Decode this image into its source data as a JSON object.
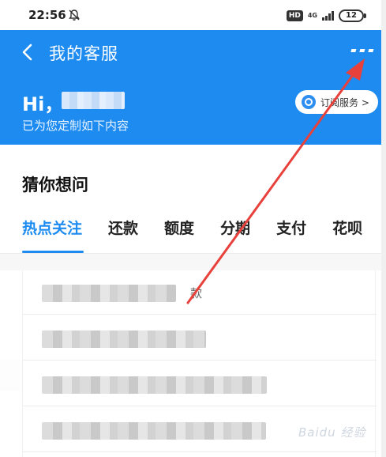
{
  "status_bar": {
    "time": "22:56",
    "hd": "HD",
    "network": "4G",
    "battery": "12"
  },
  "nav": {
    "title": "我的客服",
    "back_icon": "chevron-left-icon",
    "more_icon": "more-dots-icon"
  },
  "greeting": {
    "hi": "Hi，",
    "subtitle": "已为您定制如下内容"
  },
  "subscribe_button": {
    "label": "订阅服务 >"
  },
  "section": {
    "title": "猜你想问"
  },
  "tabs": [
    {
      "label": "热点关注",
      "active": true
    },
    {
      "label": "还款",
      "active": false
    },
    {
      "label": "额度",
      "active": false
    },
    {
      "label": "分期",
      "active": false
    },
    {
      "label": "支付",
      "active": false
    },
    {
      "label": "花呗",
      "active": false
    }
  ],
  "list": {
    "first_item_tail": "款"
  },
  "watermark": "Baidu 经验",
  "colors": {
    "brand_blue": "#1d8bf0",
    "annotation_red": "#e8403b"
  }
}
